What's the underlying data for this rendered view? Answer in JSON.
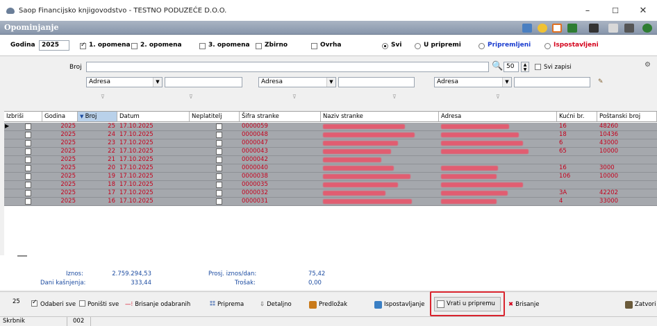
{
  "window": {
    "title": "Saop Financijsko knjigovodstvo - TESTNO PODUZEĆE D.O.O.",
    "minimize": "–",
    "maximize": "☐",
    "close": "✕"
  },
  "module": {
    "title": "Opominjanje"
  },
  "filters": {
    "year_label": "Godina",
    "year_value": "2025",
    "opomena1": "1. opomena",
    "opomena2": "2. opomena",
    "opomena3": "3. opomena",
    "zbirno": "Zbirno",
    "ovrha": "Ovrha",
    "svi": "Svi",
    "u_pripremi": "U pripremi",
    "pripremljeni": "Pripremljeni",
    "ispostavljeni": "Ispostavljeni"
  },
  "search": {
    "broj_label": "Broj",
    "limit": "50",
    "svi_zapisi": "Svi zapisi",
    "combo1": "Adresa",
    "combo2": "Adresa",
    "combo3": "Adresa"
  },
  "grid": {
    "headers": [
      "Izbriši",
      "Godina",
      "Broj",
      "Datum",
      "Neplatitelj",
      "Šifra stranke",
      "Naziv stranke",
      "Adresa",
      "Kućni br.",
      "Poštanski broj"
    ],
    "rows": [
      {
        "godina": "2025",
        "broj": "25",
        "datum": "17.10.2025",
        "sifra": "0000059",
        "kucni": "16",
        "posta": "48260"
      },
      {
        "godina": "2025",
        "broj": "24",
        "datum": "17.10.2025",
        "sifra": "0000048",
        "kucni": "18",
        "posta": "10436"
      },
      {
        "godina": "2025",
        "broj": "23",
        "datum": "17.10.2025",
        "sifra": "0000047",
        "kucni": "6",
        "posta": "43000"
      },
      {
        "godina": "2025",
        "broj": "22",
        "datum": "17.10.2025",
        "sifra": "0000043",
        "kucni": "65",
        "posta": "10000"
      },
      {
        "godina": "2025",
        "broj": "21",
        "datum": "17.10.2025",
        "sifra": "0000042",
        "kucni": "",
        "posta": ""
      },
      {
        "godina": "2025",
        "broj": "20",
        "datum": "17.10.2025",
        "sifra": "0000040",
        "kucni": "16",
        "posta": "3000"
      },
      {
        "godina": "2025",
        "broj": "19",
        "datum": "17.10.2025",
        "sifra": "0000038",
        "kucni": "106",
        "posta": "10000"
      },
      {
        "godina": "2025",
        "broj": "18",
        "datum": "17.10.2025",
        "sifra": "0000035",
        "kucni": "",
        "posta": ""
      },
      {
        "godina": "2025",
        "broj": "17",
        "datum": "17.10.2025",
        "sifra": "0000032",
        "kucni": "3A",
        "posta": "42202"
      },
      {
        "godina": "2025",
        "broj": "16",
        "datum": "17.10.2025",
        "sifra": "0000031",
        "kucni": "4",
        "posta": "33000"
      }
    ]
  },
  "totals": {
    "iznos_label": "Iznos:",
    "iznos_value": "2.759.294,53",
    "dani_label": "Dani kašnjenja:",
    "dani_value": "333,44",
    "prosj_label": "Prosj. iznos/dan:",
    "prosj_value": "75,42",
    "trosak_label": "Trošak:",
    "trosak_value": "0,00"
  },
  "actions": {
    "count": "25",
    "odaberi_sve": "Odaberi sve",
    "ponisti_sve": "Poništi sve",
    "brisanje_odabranih": "Brisanje odabranih",
    "priprema": "Priprema",
    "detaljno": "Detaljno",
    "predlozak": "Predložak",
    "ispostavljanje": "Ispostavljanje",
    "vrati_u_pripremu": "Vrati u pripremu",
    "brisanje": "Brisanje",
    "zatvori": "Zatvori"
  },
  "status": {
    "user": "Skrbnik",
    "code": "002"
  }
}
